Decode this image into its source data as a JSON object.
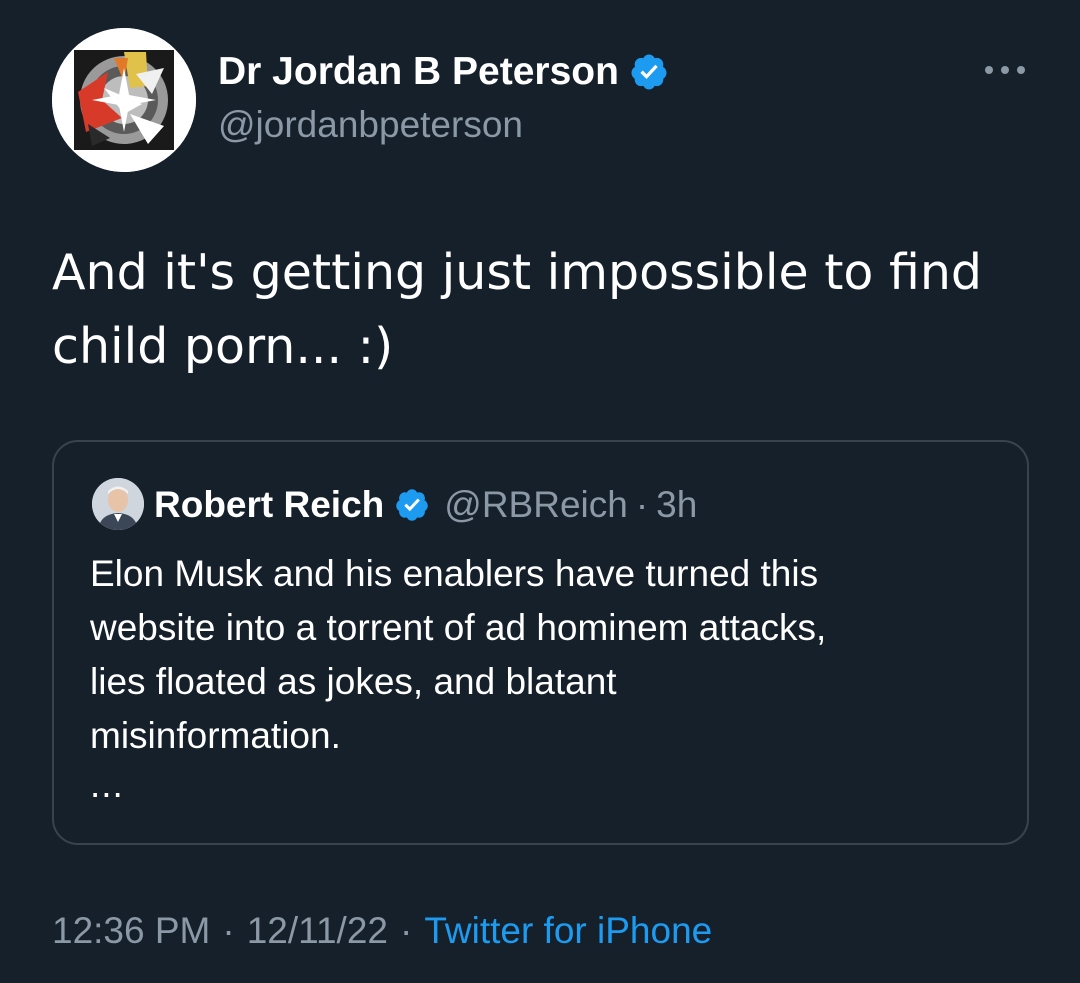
{
  "tweet": {
    "author": {
      "display_name": "Dr Jordan B Peterson",
      "handle": "@jordanbpeterson",
      "verified": true,
      "avatar_icon": "abstract-logo-avatar"
    },
    "text_line1": "And it's getting just impossible to find",
    "text_line2": "child porn... :)",
    "more_icon": "more-horizontal-icon",
    "quote": {
      "display_name": "Robert Reich",
      "handle": "@RBReich",
      "separator": "·",
      "time": "3h",
      "verified": true,
      "avatar_icon": "portrait-avatar",
      "text_line1": "Elon Musk and his enablers have turned this",
      "text_line2": "website into a torrent of ad hominem attacks,",
      "text_line3": "lies floated as jokes, and blatant",
      "text_line4": "misinformation.",
      "ellipsis": "..."
    },
    "footer": {
      "time": "12:36 PM",
      "separator1": "·",
      "date": "12/11/22",
      "separator2": "·",
      "source": "Twitter for iPhone"
    }
  },
  "colors": {
    "background": "#15202b",
    "secondary_text": "#8b98a5",
    "accent": "#1d9bf0",
    "border": "#38444d"
  }
}
